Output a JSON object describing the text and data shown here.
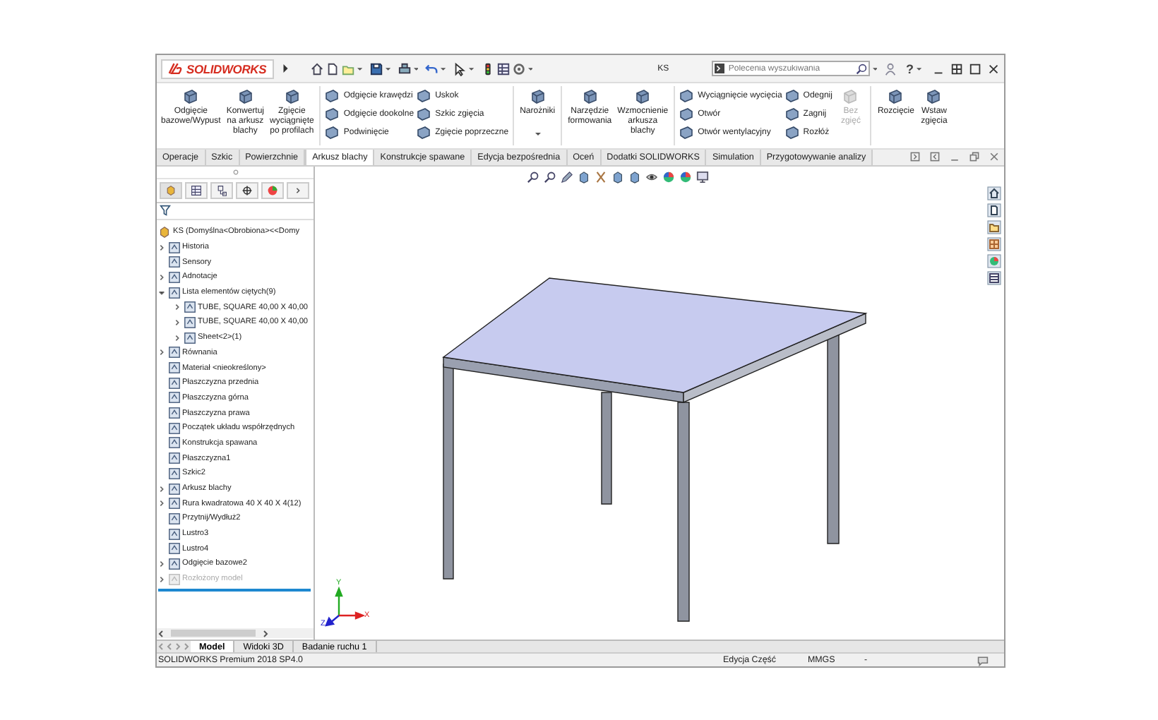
{
  "title_bar": {
    "logo": "SOLIDWORKS",
    "title": "KS",
    "search": {
      "placeholder": "Polecenia wyszukiwania"
    },
    "help": "?"
  },
  "ribbon": [
    [
      {
        "kind": "large",
        "lines": [
          "Odgięcie",
          "bazowe/Wypust"
        ],
        "disabled": false,
        "dropdown": false
      },
      {
        "kind": "large",
        "lines": [
          "Konwertuj",
          "na arkusz",
          "blachy"
        ],
        "disabled": false,
        "dropdown": false
      },
      {
        "kind": "large",
        "lines": [
          "Zgięcie",
          "wyciągnięte",
          "po profilach"
        ],
        "disabled": false,
        "dropdown": false
      }
    ],
    [
      {
        "kind": "column",
        "items": [
          "Odgięcie krawędzi",
          "Odgięcie dookolne",
          "Podwinięcie"
        ]
      },
      {
        "kind": "column",
        "items": [
          "Uskok",
          "Szkic zgięcia",
          "Zgięcie poprzeczne"
        ]
      }
    ],
    [
      {
        "kind": "large",
        "lines": [
          "Narożniki"
        ],
        "disabled": false,
        "dropdown": true
      }
    ],
    [
      {
        "kind": "large",
        "lines": [
          "Narzędzie",
          "formowania"
        ],
        "disabled": false,
        "dropdown": false
      },
      {
        "kind": "large",
        "lines": [
          "Wzmocnienie",
          "arkusza",
          "blachy"
        ],
        "disabled": false,
        "dropdown": false
      }
    ],
    [
      {
        "kind": "column",
        "items": [
          "Wyciągnięcie wycięcia",
          "Otwór",
          "Otwór wentylacyjny"
        ]
      },
      {
        "kind": "column",
        "items": [
          "Odegnij",
          "Zagnij",
          "Rozłóż"
        ]
      },
      {
        "kind": "large",
        "lines": [
          "Bez",
          "zgięć"
        ],
        "disabled": true,
        "dropdown": false
      }
    ],
    [
      {
        "kind": "large",
        "lines": [
          "Rozcięcie"
        ],
        "disabled": false,
        "dropdown": false
      },
      {
        "kind": "large",
        "lines": [
          "Wstaw",
          "zgięcia"
        ],
        "disabled": false,
        "dropdown": false
      }
    ]
  ],
  "tabs": [
    {
      "label": "Operacje",
      "selected": false
    },
    {
      "label": "Szkic",
      "selected": false
    },
    {
      "label": "Powierzchnie",
      "selected": false
    },
    {
      "label": "Arkusz blachy",
      "selected": true
    },
    {
      "label": "Konstrukcje spawane",
      "selected": false
    },
    {
      "label": "Edycja bezpośrednia",
      "selected": false
    },
    {
      "label": "Oceń",
      "selected": false
    },
    {
      "label": "Dodatki SOLIDWORKS",
      "selected": false
    },
    {
      "label": "Simulation",
      "selected": false
    },
    {
      "label": "Przygotowywanie analizy",
      "selected": false
    }
  ],
  "axis_triad": {
    "x": "X",
    "y": "Y",
    "z": "Z"
  },
  "feature_tree": {
    "root": {
      "label": "KS  (Domyślna<Obrobiona><<Domy",
      "children": [
        {
          "label": "Historia",
          "expanded": false,
          "disabled": false
        },
        {
          "label": "Sensory",
          "disabled": false
        },
        {
          "label": "Adnotacje",
          "expanded": false,
          "disabled": false
        },
        {
          "label": "Lista elementów ciętych(9)",
          "expanded": true,
          "disabled": false,
          "children": [
            {
              "label": "TUBE, SQUARE 40,00 X 40,00",
              "expanded": false,
              "disabled": false
            },
            {
              "label": "TUBE, SQUARE 40,00 X 40,00",
              "expanded": false,
              "disabled": false
            },
            {
              "label": "Sheet<2>(1)",
              "expanded": false,
              "disabled": false
            }
          ]
        },
        {
          "label": "Równania",
          "expanded": false,
          "disabled": false
        },
        {
          "label": "Materiał <nieokreślony>",
          "disabled": false
        },
        {
          "label": "Płaszczyzna przednia",
          "disabled": false
        },
        {
          "label": "Płaszczyzna górna",
          "disabled": false
        },
        {
          "label": "Płaszczyzna prawa",
          "disabled": false
        },
        {
          "label": "Początek układu współrzędnych",
          "disabled": false
        },
        {
          "label": "Konstrukcja spawana",
          "disabled": false
        },
        {
          "label": "Płaszczyzna1",
          "disabled": false
        },
        {
          "label": "Szkic2",
          "disabled": false
        },
        {
          "label": "Arkusz blachy",
          "expanded": false,
          "disabled": false
        },
        {
          "label": "Rura kwadratowa 40 X 40 X 4(12)",
          "expanded": false,
          "disabled": false
        },
        {
          "label": "Przytnij/Wydłuż2",
          "disabled": false
        },
        {
          "label": "Lustro3",
          "disabled": false
        },
        {
          "label": "Lustro4",
          "disabled": false
        },
        {
          "label": "Odgięcie bazowe2",
          "expanded": false,
          "disabled": false
        },
        {
          "label": "Rozłożony model",
          "expanded": false,
          "disabled": true
        }
      ]
    }
  },
  "bottom_tabs": [
    {
      "label": "Model",
      "selected": true
    },
    {
      "label": "Widoki 3D",
      "selected": false
    },
    {
      "label": "Badanie ruchu 1",
      "selected": false
    }
  ],
  "status_bar": {
    "product": "SOLIDWORKS Premium 2018 SP4.0",
    "mode": "Edycja Część",
    "units": "MMGS",
    "extra": "-"
  }
}
